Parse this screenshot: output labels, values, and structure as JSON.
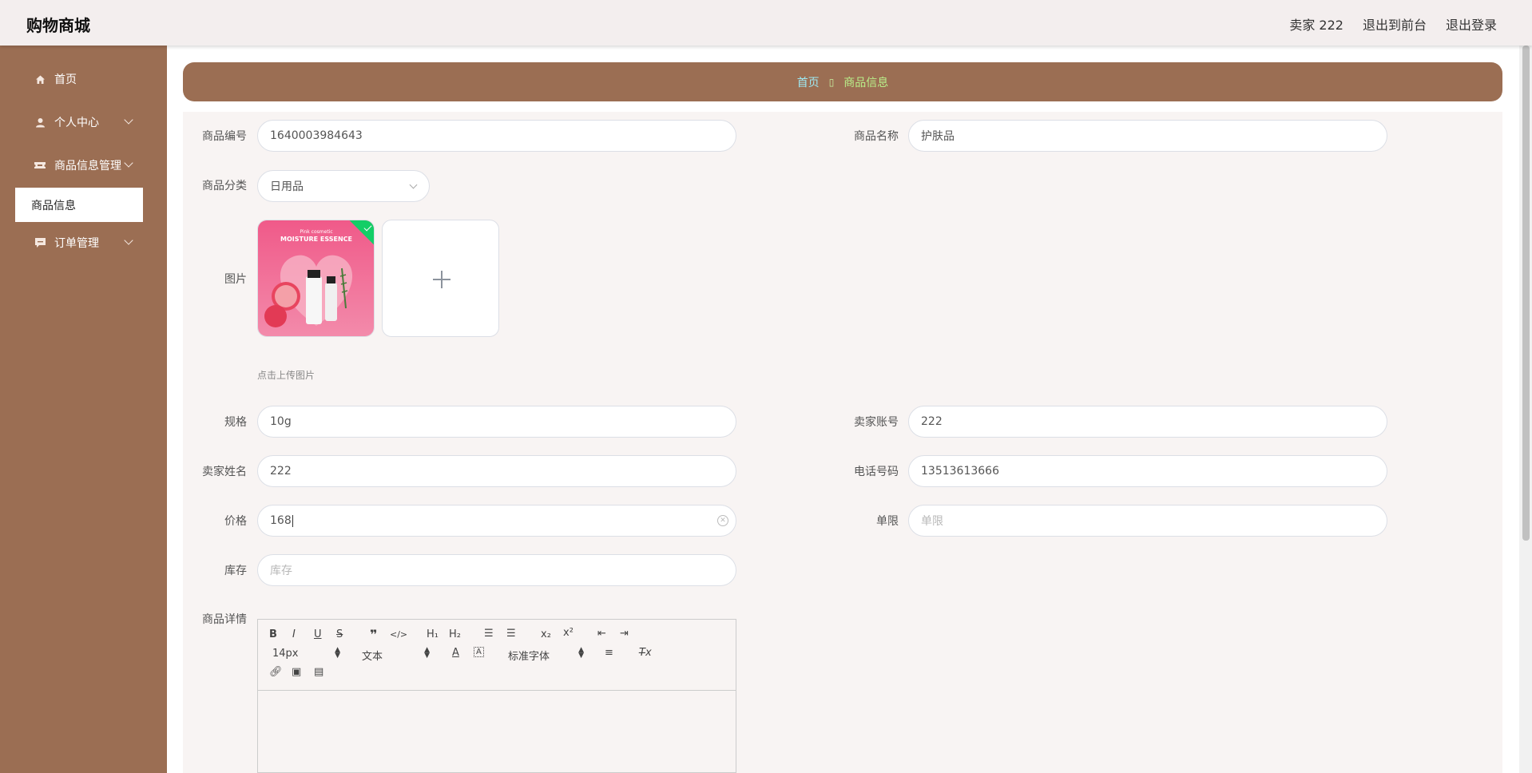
{
  "header": {
    "brand": "购物商城",
    "user": "卖家 222",
    "to_front": "退出到前台",
    "logout": "退出登录"
  },
  "sidebar": {
    "items": [
      {
        "label": "首页",
        "icon": "home-icon"
      },
      {
        "label": "个人中心",
        "icon": "user-icon"
      },
      {
        "label": "商品信息管理",
        "icon": "ticket-icon"
      },
      {
        "label": "订单管理",
        "icon": "chat-icon"
      }
    ],
    "active_sub": "商品信息"
  },
  "breadcrumb": {
    "home": "首页",
    "separator": "▯",
    "current": "商品信息"
  },
  "form": {
    "code_label": "商品编号",
    "code_value": "1640003984643",
    "name_label": "商品名称",
    "name_value": "护肤品",
    "category_label": "商品分类",
    "category_value": "日用品",
    "image_label": "图片",
    "image_text_brand": "Pink cosmetic",
    "image_text_title": "MOISTURE ESSENCE",
    "upload_tip": "点击上传图片",
    "spec_label": "规格",
    "spec_value": "10g",
    "seller_account_label": "卖家账号",
    "seller_account_value": "222",
    "seller_name_label": "卖家姓名",
    "seller_name_value": "222",
    "phone_label": "电话号码",
    "phone_value": "13513613666",
    "price_label": "价格",
    "price_value": "168",
    "limit_label": "单限",
    "limit_placeholder": "单限",
    "stock_label": "库存",
    "stock_placeholder": "库存",
    "detail_label": "商品详情"
  },
  "editor": {
    "size_value": "14px",
    "header_value": "文本",
    "font_value": "标准字体"
  },
  "colors": {
    "sidebar": "#9b6e53",
    "accent_success": "#13ce66",
    "breadcrumb_home": "#9ee8f2",
    "breadcrumb_current": "#b9ef8a"
  }
}
